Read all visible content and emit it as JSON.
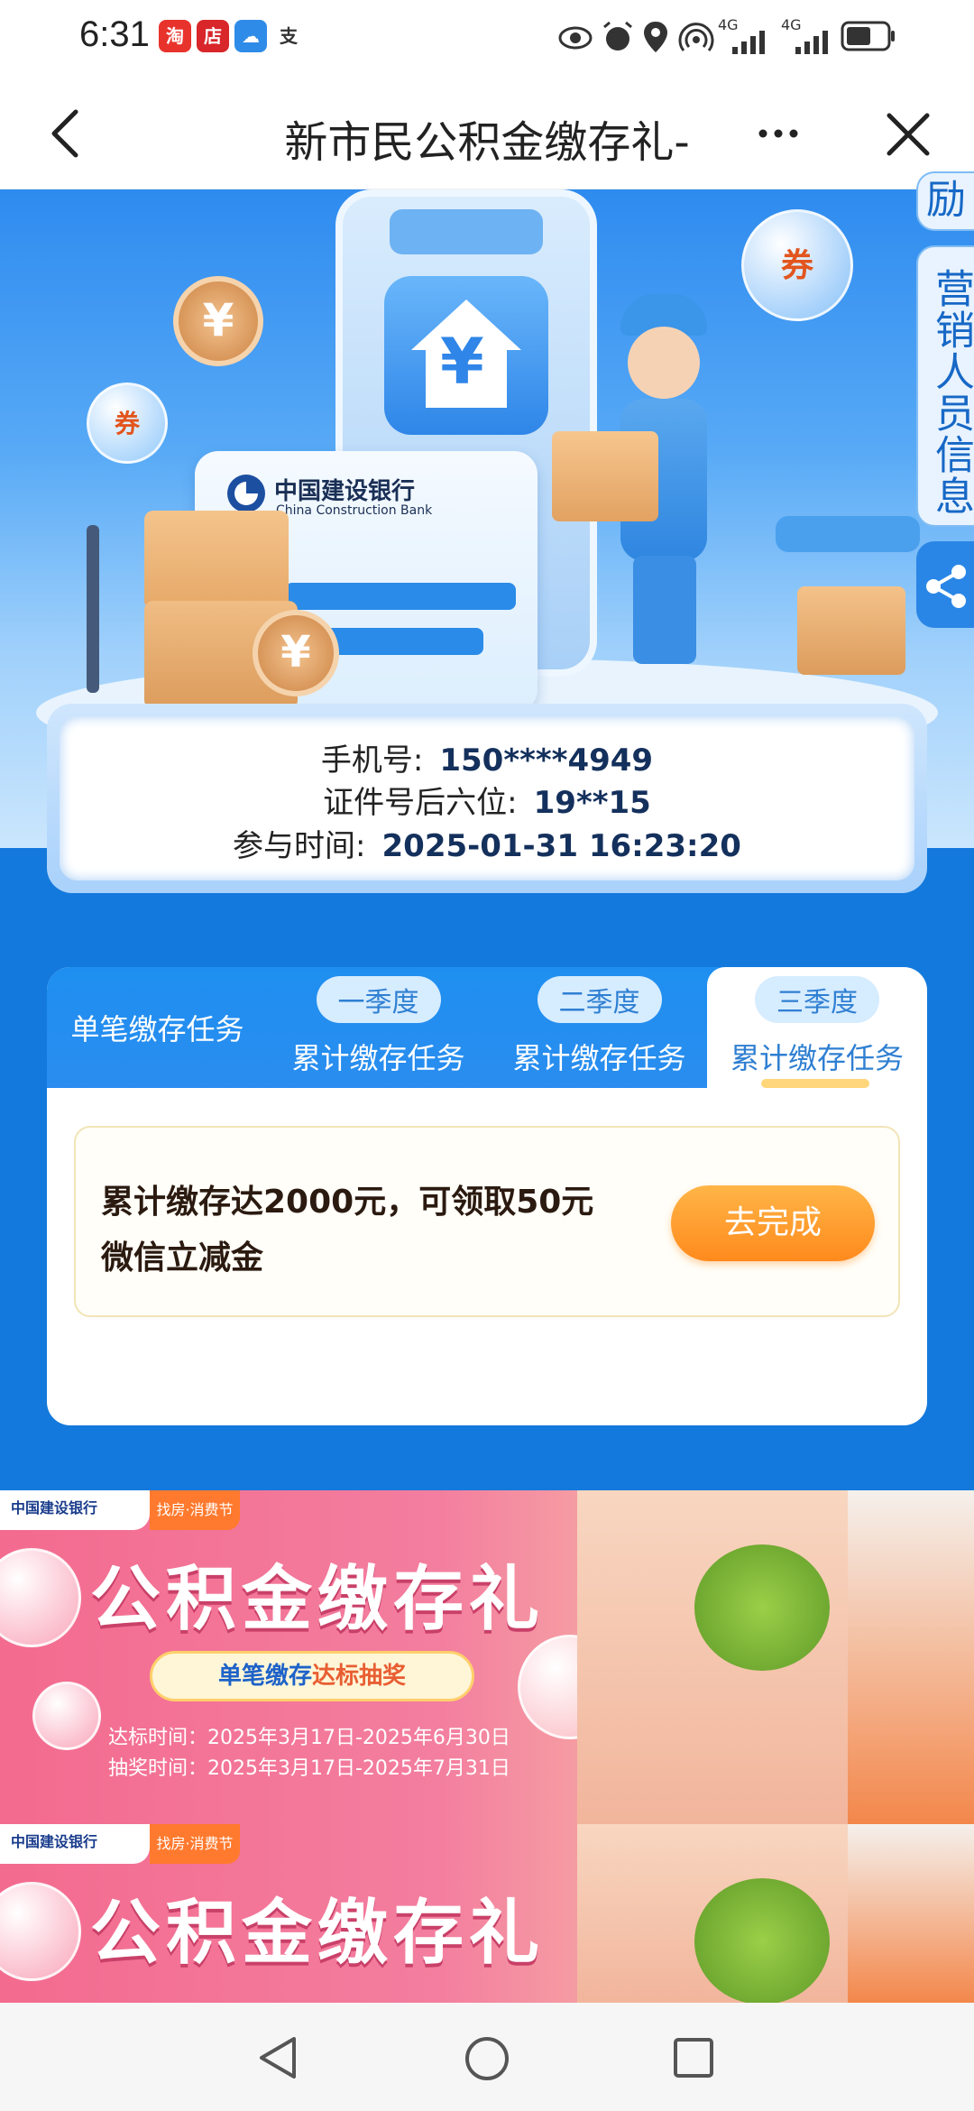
{
  "status_bar": {
    "time": "6:31",
    "app_icons": [
      "taobao-app-icon",
      "shop-app-icon",
      "weather-app-icon",
      "alipay-icon"
    ],
    "right_icons": [
      "eye-icon",
      "alarm-icon",
      "location-icon",
      "hotspot-icon",
      "signal-4g-icon",
      "signal-4g-icon",
      "battery-icon"
    ],
    "net1": "4G",
    "net2": "4G"
  },
  "nav": {
    "title": "新市民公积金缴存礼-",
    "back_icon": "back-chevron-icon",
    "more_icon": "more-dots-icon",
    "close_icon": "close-icon"
  },
  "hero": {
    "bank_name_cn": "中国建设银行",
    "bank_name_en": "China Construction Bank",
    "currency_symbol": "¥",
    "coupon_text": "券",
    "side_tabs": [
      {
        "label": "励"
      },
      {
        "label": "营销人员信息"
      }
    ],
    "share_icon": "share-icon"
  },
  "info": {
    "phone_label": "手机号:",
    "phone_value": "150****4949",
    "id_label": "证件号后六位:",
    "id_value": "19**15",
    "time_label": "参与时间:",
    "time_value": "2025-01-31 16:23:20"
  },
  "tasks": {
    "tabs": [
      {
        "pill": "",
        "label": "单笔缴存任务"
      },
      {
        "pill": "一季度",
        "label": "累计缴存任务"
      },
      {
        "pill": "二季度",
        "label": "累计缴存任务"
      },
      {
        "pill": "三季度",
        "label": "累计缴存任务"
      }
    ],
    "active_tab": 3,
    "task_line1": "累计缴存达2000元，可领取50元",
    "task_line2": "微信立减金",
    "task_button": "去完成"
  },
  "banners": [
    {
      "logo": "中国建设银行",
      "fest": "找房·消费节",
      "title": "公积金缴存礼",
      "pill_blue": "单笔缴存",
      "pill_rest": "达标抽奖",
      "date1": "达标时间：2025年3月17日-2025年6月30日",
      "date2": "抽奖时间：2025年3月17日-2025年7月31日"
    },
    {
      "logo": "中国建设银行",
      "fest": "找房·消费节",
      "title": "公积金缴存礼"
    }
  ],
  "bottom_nav": {
    "back_icon": "nav-back-triangle-icon",
    "home_icon": "nav-home-circle-icon",
    "recents_icon": "nav-recents-square-icon"
  },
  "colors": {
    "primary_blue": "#1479dc",
    "accent_orange": "#ff8a1d",
    "banner_pink": "#f36b8f"
  }
}
